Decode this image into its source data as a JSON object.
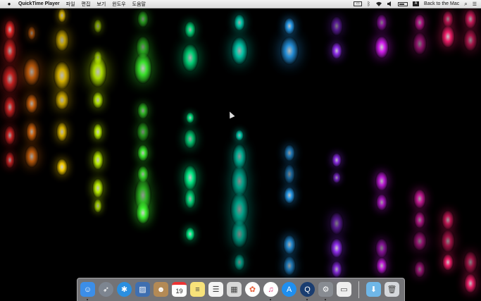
{
  "menubar": {
    "apple_icon": "",
    "app_name": "QuickTime Player",
    "menus": [
      "파일",
      "편집",
      "보기",
      "윈도우",
      "도움말"
    ],
    "status": {
      "screen_icon": "screen-mirroring-icon",
      "bluetooth": "᛫",
      "wifi": "wifi-icon",
      "volume": "volume-icon",
      "keyboard": "A",
      "back_to_mac": "Back to the Mac",
      "search": "⌕",
      "list": "☰"
    }
  },
  "wallpaper": {
    "description_colors": [
      "#ff2a2a",
      "#ff7a10",
      "#ffd400",
      "#c8ff00",
      "#40ff30",
      "#00ff90",
      "#00ffd8",
      "#2aa8ff",
      "#9a30ff",
      "#e020ff",
      "#ff20c0",
      "#ff2070"
    ]
  },
  "dock": {
    "apps": [
      {
        "name": "Finder",
        "icon": "finder-icon",
        "glyph": "☺",
        "color": "#3c8ee8"
      },
      {
        "name": "Launchpad",
        "icon": "rocket-icon",
        "glyph": "➶",
        "color": "#7d8590"
      },
      {
        "name": "Safari",
        "icon": "compass-icon",
        "glyph": "✱",
        "color": "#2a8fe0"
      },
      {
        "name": "Preview",
        "icon": "photo-icon",
        "glyph": "▨",
        "color": "#3f6fb0"
      },
      {
        "name": "Contacts",
        "icon": "contacts-icon",
        "glyph": "☻",
        "color": "#b48a55"
      },
      {
        "name": "Calendar",
        "icon": "calendar-icon",
        "glyph": "19",
        "color": "#ffffff"
      },
      {
        "name": "Notes",
        "icon": "notes-icon",
        "glyph": "≡",
        "color": "#f7e27a"
      },
      {
        "name": "Reminders",
        "icon": "reminders-icon",
        "glyph": "☰",
        "color": "#f4f4f4"
      },
      {
        "name": "Photo Browser",
        "icon": "slides-icon",
        "glyph": "▦",
        "color": "#d8d8d8"
      },
      {
        "name": "Photos",
        "icon": "photos-flower-icon",
        "glyph": "✿",
        "color": "#ffffff"
      },
      {
        "name": "iTunes",
        "icon": "music-note-icon",
        "glyph": "♫",
        "color": "#ffffff"
      },
      {
        "name": "App Store",
        "icon": "appstore-icon",
        "glyph": "A",
        "color": "#1f8ff0"
      },
      {
        "name": "QuickTime Player",
        "icon": "quicktime-icon",
        "glyph": "Q",
        "color": "#1a3d70"
      },
      {
        "name": "System Preferences",
        "icon": "gear-icon",
        "glyph": "⚙",
        "color": "#888c92"
      },
      {
        "name": "Mail Drafts",
        "icon": "tray-icon",
        "glyph": "▭",
        "color": "#eeeeee"
      },
      {
        "name": "Downloads",
        "icon": "folder-icon",
        "glyph": "⬇",
        "color": "#6fb7e8"
      },
      {
        "name": "Trash",
        "icon": "trash-icon",
        "glyph": "🗑",
        "color": "#d5d8dc"
      }
    ],
    "calendar_day": "19"
  }
}
